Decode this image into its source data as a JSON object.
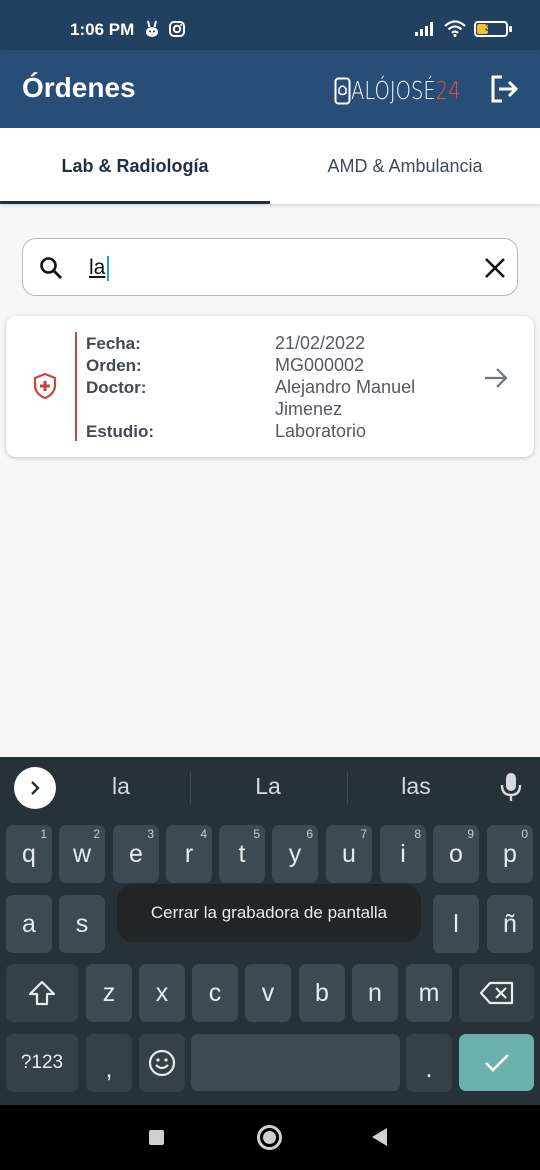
{
  "status_bar": {
    "time": "1:06 PM",
    "battery": "35",
    "icons": [
      "bunny-icon",
      "instagram-icon",
      "signal-icon",
      "wifi-icon",
      "battery-icon"
    ]
  },
  "app_bar": {
    "title": "Órdenes",
    "brand_main": "ALÓJOSÉ",
    "brand_accent": "24",
    "brand_accent_color": "#e94b3c",
    "background": "#284e78"
  },
  "tabs": [
    {
      "label": "Lab & Radiología",
      "active": true
    },
    {
      "label": "AMD & Ambulancia",
      "active": false
    }
  ],
  "search": {
    "value": "la"
  },
  "order_card": {
    "labels": {
      "fecha": "Fecha:",
      "orden": "Orden:",
      "doctor": "Doctor:",
      "estudio": "Estudio:"
    },
    "values": {
      "fecha": "21/02/2022",
      "orden": "MG000002",
      "doctor_line1": "Alejandro Manuel",
      "doctor_line2": "Jimenez",
      "estudio": "Laboratorio"
    },
    "accent_color": "#c9453b"
  },
  "keyboard": {
    "suggestions": [
      "la",
      "La",
      "las"
    ],
    "row1": [
      {
        "k": "q",
        "h": "1"
      },
      {
        "k": "w",
        "h": "2"
      },
      {
        "k": "e",
        "h": "3"
      },
      {
        "k": "r",
        "h": "4"
      },
      {
        "k": "t",
        "h": "5"
      },
      {
        "k": "y",
        "h": "6"
      },
      {
        "k": "u",
        "h": "7"
      },
      {
        "k": "i",
        "h": "8"
      },
      {
        "k": "o",
        "h": "9"
      },
      {
        "k": "p",
        "h": "0"
      }
    ],
    "row2": [
      "a",
      "s",
      "l",
      "ñ"
    ],
    "row3": [
      "z",
      "x",
      "c",
      "v",
      "b",
      "n",
      "m"
    ],
    "row4": {
      "symbols": "?123",
      "comma": ",",
      "period": "."
    },
    "toast": "Cerrar la grabadora de pantalla",
    "enter_color": "#6ab0ac"
  }
}
